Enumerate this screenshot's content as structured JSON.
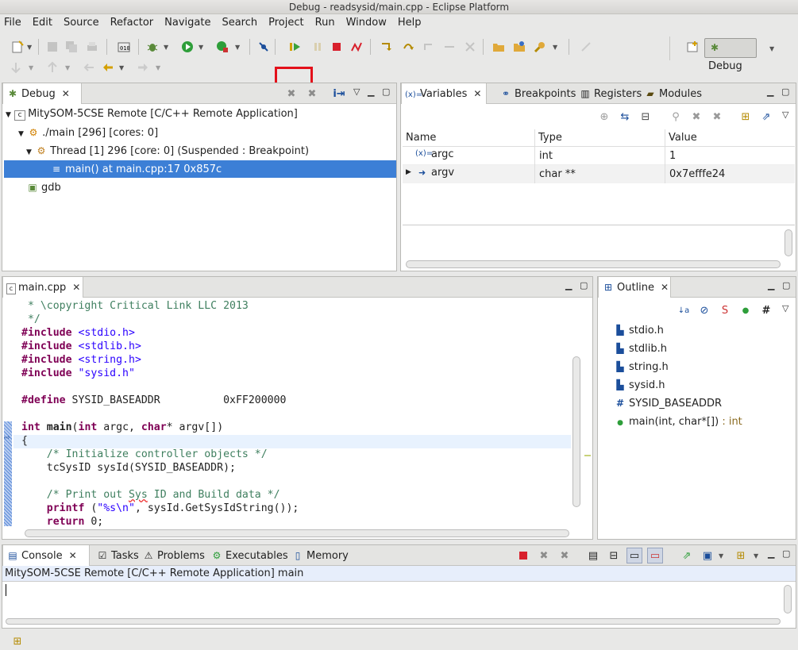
{
  "window": {
    "title": "Debug - readsysid/main.cpp - Eclipse Platform"
  },
  "menu": [
    "File",
    "Edit",
    "Source",
    "Refactor",
    "Navigate",
    "Search",
    "Project",
    "Run",
    "Window",
    "Help"
  ],
  "perspective": {
    "label": "Debug"
  },
  "debug_view": {
    "tab": "Debug",
    "tree": [
      {
        "label": "MitySOM-5CSE Remote [C/C++ Remote Application]",
        "icon": "c-launch-icon"
      },
      {
        "label": "./main [296] [cores: 0]",
        "icon": "process-icon"
      },
      {
        "label": "Thread [1] 296 [core: 0] (Suspended : Breakpoint)",
        "icon": "thread-icon"
      },
      {
        "label": "main() at main.cpp:17 0x857c",
        "icon": "stack-frame-icon"
      },
      {
        "label": "gdb",
        "icon": "gdb-icon"
      }
    ]
  },
  "variables_view": {
    "tabs": [
      "Variables",
      "Breakpoints",
      "Registers",
      "Modules"
    ],
    "columns": [
      "Name",
      "Type",
      "Value"
    ],
    "rows": [
      {
        "name": "argc",
        "type": "int",
        "value": "1"
      },
      {
        "name": "argv",
        "type": "char **",
        "value": "0x7efffe24"
      }
    ]
  },
  "editor": {
    "tab": "main.cpp",
    "lines": [
      " * \\copyright Critical Link LLC 2013",
      " */",
      "#include <stdio.h>",
      "#include <stdlib.h>",
      "#include <string.h>",
      "#include \"sysid.h\"",
      "",
      "#define SYSID_BASEADDR          0xFF200000",
      "",
      "int main(int argc, char* argv[])",
      "{",
      "    /* Initialize controller objects */",
      "    tcSysID sysId(SYSID_BASEADDR);",
      "",
      "    /* Print out Sys ID and Build data */",
      "    printf (\"%s\\n\", sysId.GetSysIdString());",
      "    return 0;"
    ]
  },
  "outline_view": {
    "tab": "Outline",
    "items": [
      {
        "label": "stdio.h",
        "kind": "include"
      },
      {
        "label": "stdlib.h",
        "kind": "include"
      },
      {
        "label": "string.h",
        "kind": "include"
      },
      {
        "label": "sysid.h",
        "kind": "include"
      },
      {
        "label": "SYSID_BASEADDR",
        "kind": "macro"
      },
      {
        "label": "main(int, char*[])",
        "suffix": " : int",
        "kind": "function"
      }
    ]
  },
  "console_view": {
    "tabs": [
      "Console",
      "Tasks",
      "Problems",
      "Executables",
      "Memory"
    ],
    "header": "MitySOM-5CSE Remote [C/C++ Remote Application] main"
  },
  "highlight": {
    "target": "resume-button",
    "color": "#e3101a"
  }
}
